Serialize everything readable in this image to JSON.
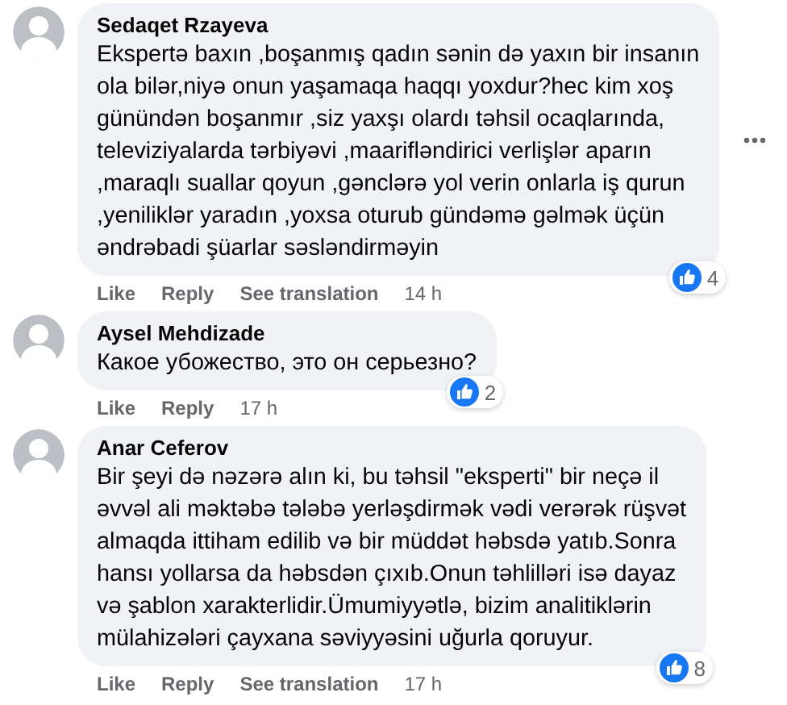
{
  "comments": [
    {
      "author": "Sedaqet Rzayeva",
      "text": "Ekspertə baxın ,boşanmış qadın sənin də yaxın bir insanın\nola bilər,niyə onun yaşamaqa haqqı yoxdur?hec kim xoş\ngünündən boşanmır ,siz yaxşı olardı təhsil ocaqlarında,\nteleviziyalarda tərbiyəvi ,maarifləndirici verlişlər aparın\n,maraqlı suallar qoyun ,gənclərə yol verin onlarla iş qurun\n,yeniliklər yaradın ,yoxsa oturub gündəmə gəlmək üçün\nəndrəbadi şüarlar səsləndirməyin",
      "actions": [
        "Like",
        "Reply",
        "See translation"
      ],
      "time": "14 h",
      "reactions": "4",
      "more_menu": true
    },
    {
      "author": "Aysel Mehdizade",
      "text": "Какое убожество, это он серьезно?",
      "actions": [
        "Like",
        "Reply"
      ],
      "time": "17 h",
      "reactions": "2",
      "more_menu": false
    },
    {
      "author": "Anar Ceferov",
      "text": "Bir şeyi də nəzərə alın ki, bu təhsil \"eksperti\" bir neçə il\nəvvəl ali məktəbə tələbə yerləşdirmək vədi verərək rüşvət\nalmaqda ittiham edilib və bir müddət həbsdə yatıb.Sonra\nhansı yollarsa da həbsdən çıxıb.Onun təhlilləri isə dayaz\nvə şablon xarakterlidir.Ümumiyyətlə, bizim analitiklərin\nmülahizələri çayxana səviyyəsini uğurla qoruyur.",
      "actions": [
        "Like",
        "Reply",
        "See translation"
      ],
      "time": "17 h",
      "reactions": "8",
      "more_menu": false
    }
  ]
}
